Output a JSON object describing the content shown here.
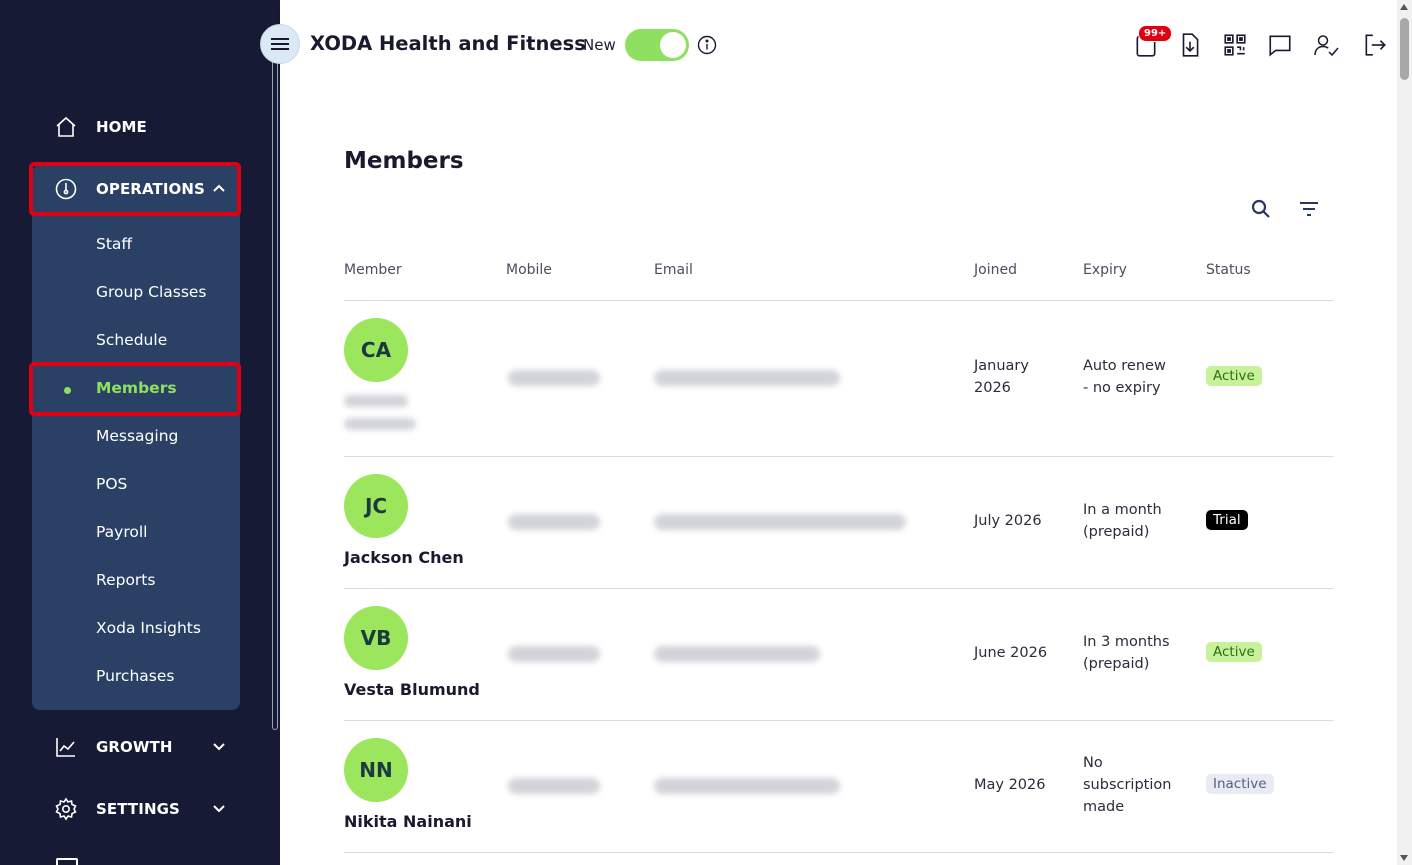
{
  "header": {
    "app_title": "XODA Health and Fitness",
    "new_label": "New",
    "new_toggle_on": true,
    "notifications_badge": "99+",
    "icons": [
      "clipboard-icon",
      "download-icon",
      "qr-code-icon",
      "chat-icon",
      "user-check-icon",
      "logout-icon"
    ]
  },
  "sidebar": {
    "home": "HOME",
    "operations": "OPERATIONS",
    "operations_items": [
      "Staff",
      "Group Classes",
      "Schedule",
      "Members",
      "Messaging",
      "POS",
      "Payroll",
      "Reports",
      "Xoda Insights",
      "Purchases"
    ],
    "active_item": "Members",
    "growth": "GROWTH",
    "settings": "SETTINGS"
  },
  "page": {
    "title": "Members",
    "columns": [
      "Member",
      "Mobile",
      "Email",
      "Joined",
      "Expiry",
      "Status"
    ]
  },
  "members": [
    {
      "initials": "CA",
      "name": "",
      "joined": "January\n2026",
      "expiry": "Auto renew\n- no expiry",
      "status": "Active"
    },
    {
      "initials": "JC",
      "name": "Jackson Chen",
      "joined": "July 2026",
      "expiry": "In a month\n(prepaid)",
      "status": "Trial"
    },
    {
      "initials": "VB",
      "name": "Vesta Blumund",
      "joined": "June 2026",
      "expiry": "In 3 months\n(prepaid)",
      "status": "Active"
    },
    {
      "initials": "NN",
      "name": "Nikita Nainani",
      "joined": "May 2026",
      "expiry": "No\nsubscription\nmade",
      "status": "Inactive"
    }
  ],
  "colors": {
    "sidebar_bg": "#161a35",
    "panel_bg": "#2a4165",
    "accent_green": "#8fe060",
    "highlight_red": "#e00012"
  }
}
